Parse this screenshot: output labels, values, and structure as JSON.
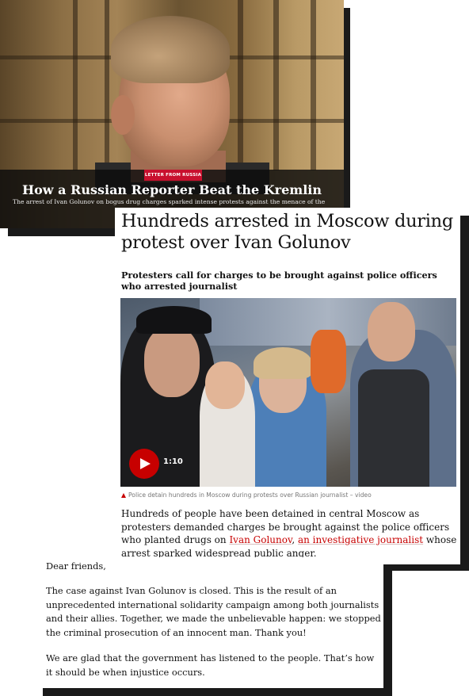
{
  "card1": {
    "badge": "LETTER FROM RUSSIA",
    "title": "How a Russian Reporter Beat the Kremlin",
    "subtitle": "The arrest of Ivan Golunov on bogus drug charges sparked intense protests against the menace of the"
  },
  "card2": {
    "headline": "Hundreds arrested in Moscow during protest over Ivan Golunov",
    "standfirst": "Protesters call for charges to be brought against police officers who arrested journalist",
    "video": {
      "duration": "1:10",
      "play_icon": "play-icon"
    },
    "caption": "Police detain hundreds in Moscow during protests over Russian journalist – video",
    "body": {
      "pre": "Hundreds of people have been detained in central Moscow as protesters demanded charges be brought against the police officers who planted drugs on ",
      "link1": "Ivan Golunov",
      "sep": ", ",
      "link2": "an investigative journalist",
      "post": " whose arrest sparked widespread public anger."
    },
    "colors": {
      "accent": "#c70000"
    }
  },
  "card3": {
    "greeting": "Dear friends,",
    "p1": "The case against Ivan Golunov is closed. This is the result of an unprecedented international solidarity campaign among both journalists and their allies. Together, we made the unbelievable happen: we stopped the criminal prosecution of an innocent man. Thank you!",
    "p2": "We are glad that the government has listened to the people. That’s how it should be when injustice occurs."
  }
}
